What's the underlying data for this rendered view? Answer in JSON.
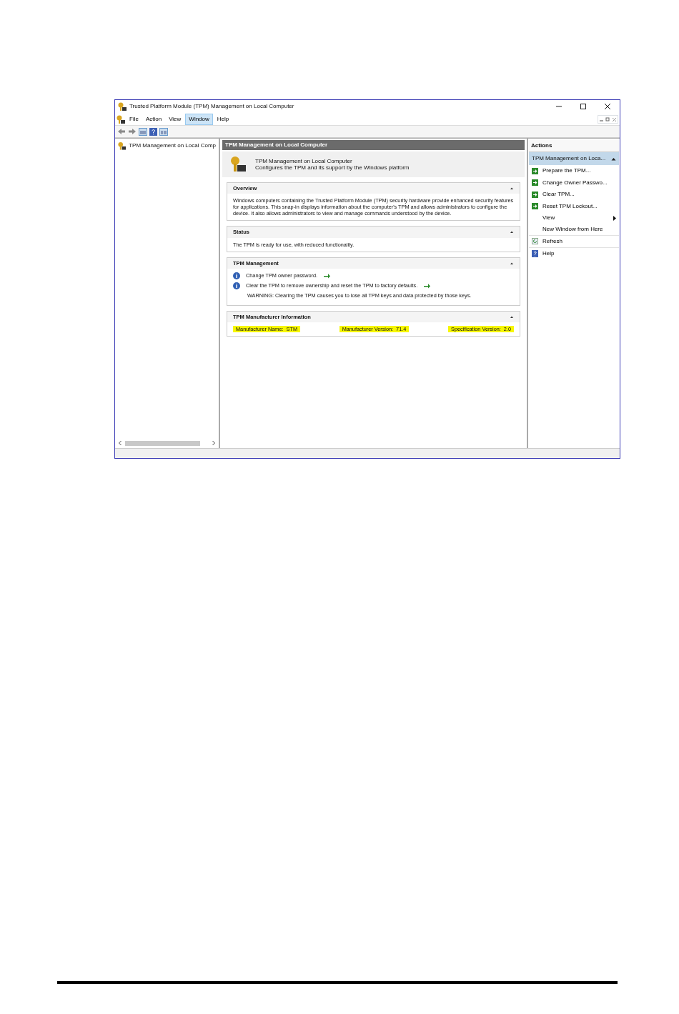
{
  "window": {
    "title": "Trusted Platform Module (TPM) Management on Local Computer"
  },
  "menu": [
    {
      "label": "File",
      "selected": false
    },
    {
      "label": "Action",
      "selected": false
    },
    {
      "label": "View",
      "selected": false
    },
    {
      "label": "Window",
      "selected": true
    },
    {
      "label": "Help",
      "selected": false
    }
  ],
  "tree": {
    "items": [
      {
        "label": "TPM Management on Local Comp"
      }
    ]
  },
  "main": {
    "header": "TPM Management on Local Computer",
    "intro": {
      "title": "TPM Management on Local Computer",
      "subtitle": "Configures the TPM and its support by the Windows platform"
    },
    "sections": [
      {
        "title": "Overview",
        "expanded": true,
        "kind": "text",
        "text": "Windows computers containing the Trusted Platform Module (TPM) security hardware provide enhanced security features for applications. This snap-in displays information about the computer's TPM and allows administrators to configure the device. It also allows administrators to view and manage commands understood by the device."
      },
      {
        "title": "Status",
        "expanded": true,
        "kind": "text",
        "text": "The TPM is ready for use, with reduced functionality."
      },
      {
        "title": "TPM Management",
        "expanded": true,
        "kind": "tasks",
        "items": [
          {
            "kind": "task",
            "text": "Change TPM owner password."
          },
          {
            "kind": "task",
            "text": "Clear the TPM to remove ownership and reset the TPM to factory defaults."
          },
          {
            "kind": "note",
            "text": "WARNING: Clearing the TPM causes you to lose all TPM keys and data protected by those keys."
          }
        ]
      },
      {
        "title": "TPM Manufacturer Information",
        "expanded": true,
        "kind": "fields",
        "fields": [
          {
            "text": "Manufacturer Name:  STM",
            "highlighted": true
          },
          {
            "text": "Manufacturer Version:  71.4",
            "highlighted": true
          },
          {
            "text": "Specification Version:  2.0",
            "highlighted": true
          }
        ]
      }
    ]
  },
  "actions": {
    "title": "Actions",
    "group": {
      "label": "TPM Management on Loca...",
      "expanded": true
    },
    "items": [
      {
        "label": "Prepare the TPM...",
        "kind": "run"
      },
      {
        "label": "Change Owner Passwo...",
        "kind": "run"
      },
      {
        "label": "Clear TPM...",
        "kind": "run"
      },
      {
        "label": "Reset TPM Lockout...",
        "kind": "run"
      },
      {
        "label": "View",
        "kind": "submenu"
      },
      {
        "label": "New Window from Here",
        "kind": "plain"
      },
      {
        "label": "Refresh",
        "kind": "refresh"
      },
      {
        "label": "Help",
        "kind": "help"
      }
    ]
  }
}
